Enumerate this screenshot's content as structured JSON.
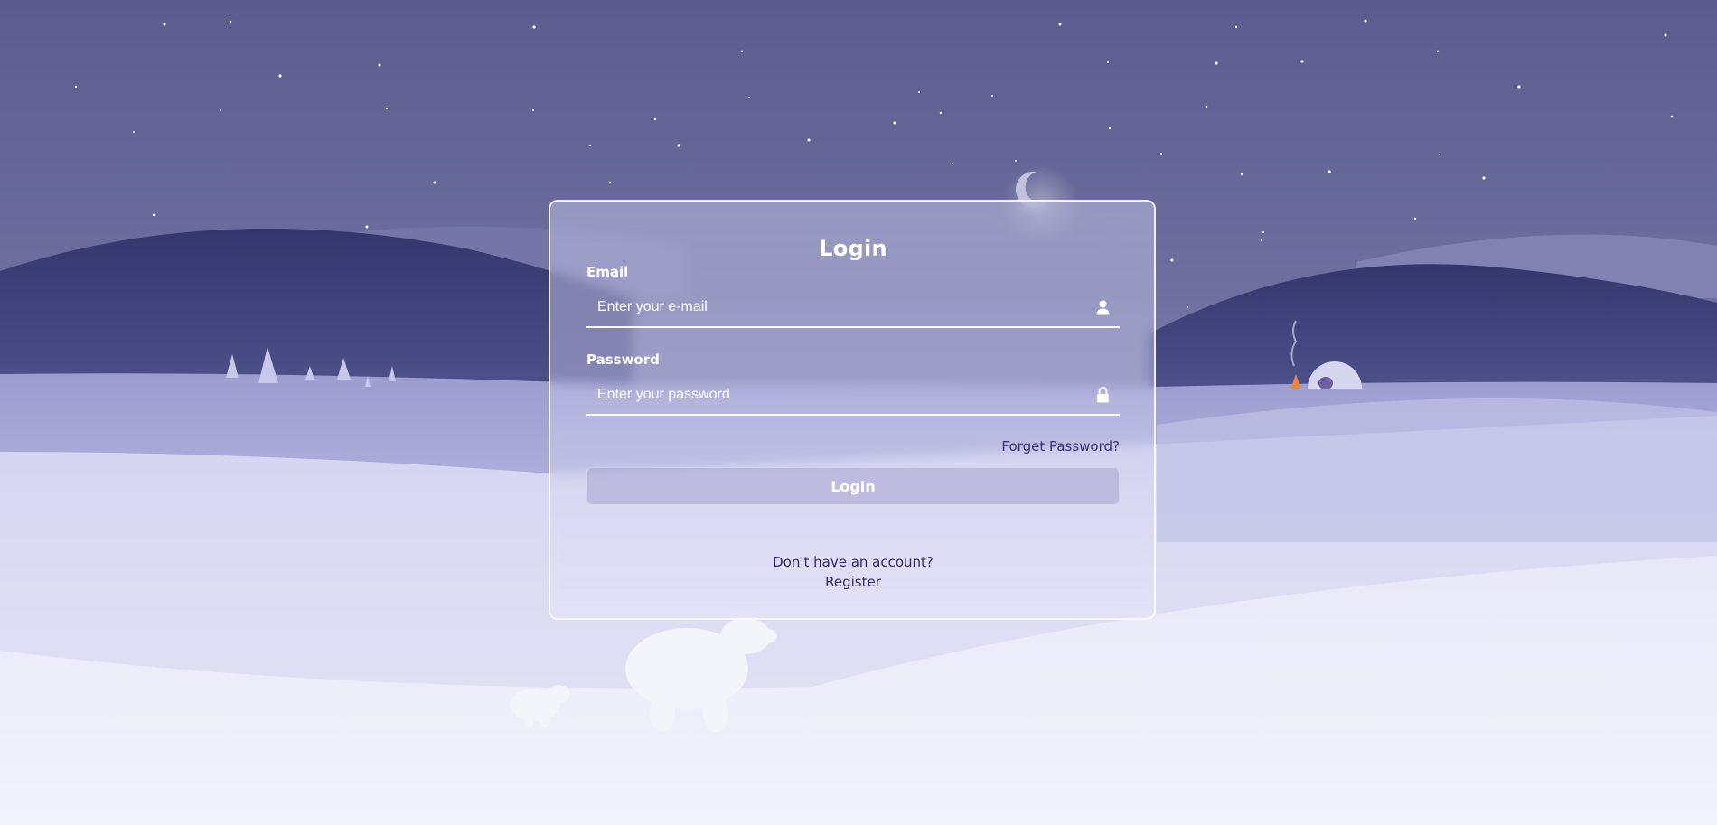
{
  "login": {
    "title": "Login",
    "email": {
      "label": "Email",
      "placeholder": "Enter your e-mail",
      "icon": "user-icon"
    },
    "password": {
      "label": "Password",
      "placeholder": "Enter your password",
      "icon": "lock-icon"
    },
    "forgot_password": "Forget Password?",
    "submit_label": "Login",
    "no_account_text": "Don't have an account?",
    "register_label": "Register"
  },
  "colors": {
    "sky_top": "#5b5d90",
    "sky_bottom": "#8586b8",
    "hill_dark": "#3c3f76",
    "snow": "#e4e4f6",
    "link": "#3b2f72"
  }
}
